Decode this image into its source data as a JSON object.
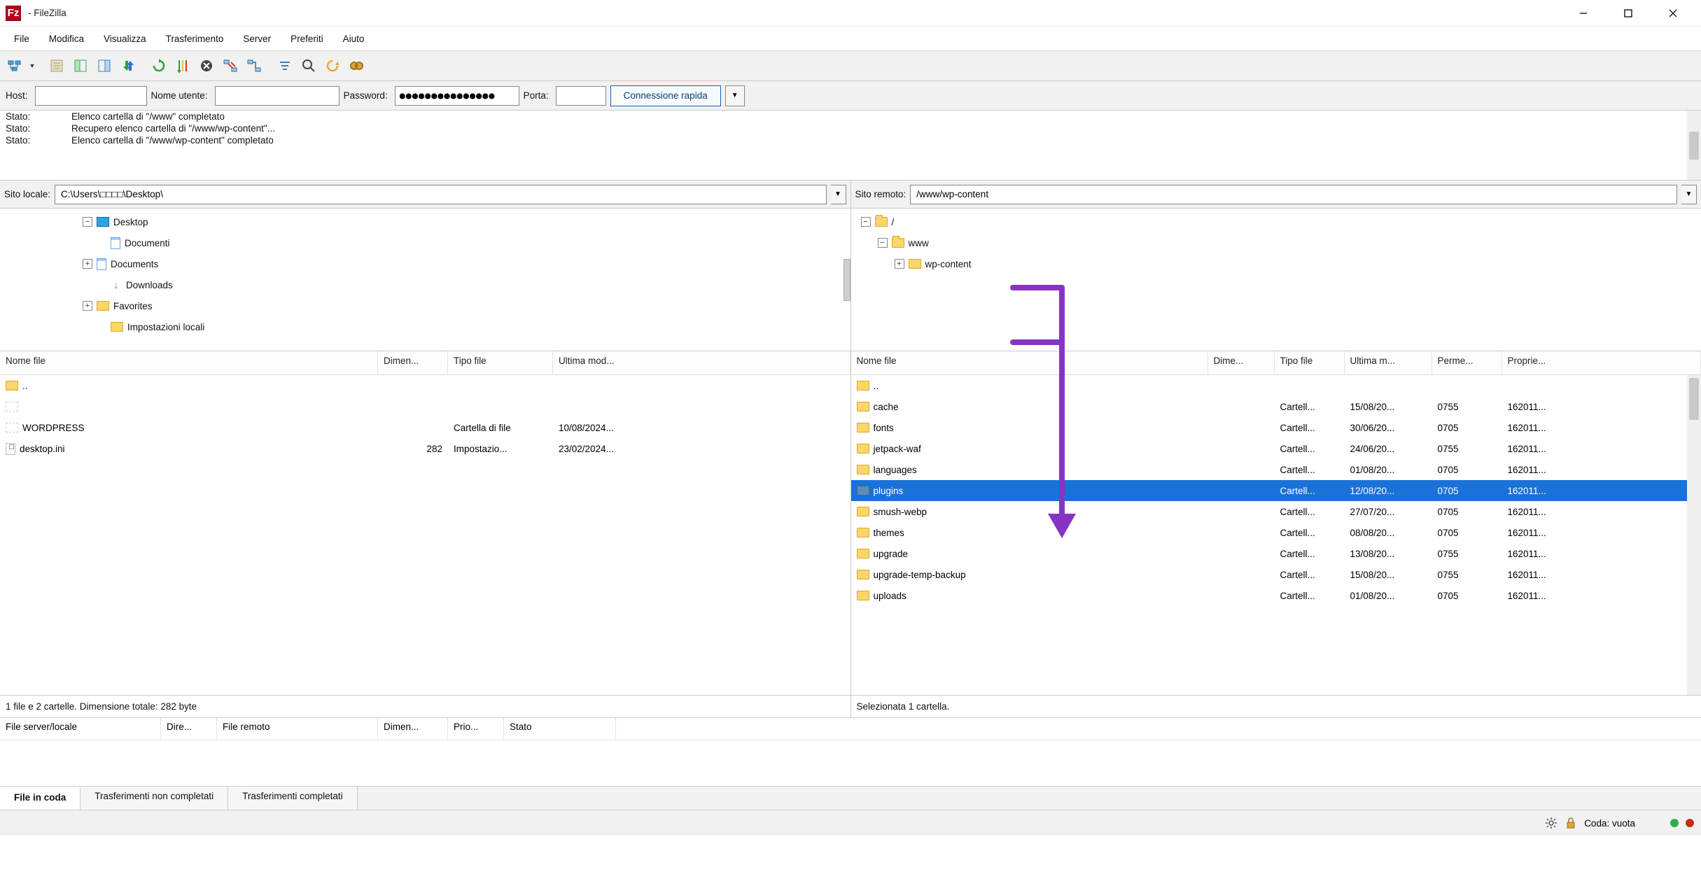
{
  "title": "- FileZilla",
  "menu": {
    "file": "File",
    "edit": "Modifica",
    "view": "Visualizza",
    "transfer": "Trasferimento",
    "server": "Server",
    "bookmarks": "Preferiti",
    "help": "Aiuto"
  },
  "quick": {
    "host_label": "Host:",
    "host": "",
    "user_label": "Nome utente:",
    "user": "",
    "pass_label": "Password:",
    "pass": "●●●●●●●●●●●●●●●",
    "port_label": "Porta:",
    "port": "",
    "connect": "Connessione rapida"
  },
  "log": [
    {
      "lbl": "Stato:",
      "msg": "Elenco cartella di \"/www\" completato"
    },
    {
      "lbl": "Stato:",
      "msg": "Recupero elenco cartella di \"/www/wp-content\"..."
    },
    {
      "lbl": "Stato:",
      "msg": "Elenco cartella di \"/www/wp-content\" completato"
    }
  ],
  "local": {
    "path_label": "Sito locale:",
    "path": "C:\\Users\\□□□□\\Desktop\\",
    "tree": [
      {
        "indent": 110,
        "exp": "-",
        "icon": "desktop",
        "txt": "Desktop"
      },
      {
        "indent": 130,
        "exp": "",
        "icon": "doc",
        "txt": "Documenti"
      },
      {
        "indent": 110,
        "exp": "+",
        "icon": "doc",
        "txt": "Documents"
      },
      {
        "indent": 130,
        "exp": "",
        "icon": "download",
        "txt": "Downloads"
      },
      {
        "indent": 110,
        "exp": "+",
        "icon": "folder",
        "txt": "Favorites"
      },
      {
        "indent": 130,
        "exp": "",
        "icon": "folder",
        "txt": "Impostazioni locali"
      }
    ],
    "headers": {
      "name": "Nome file",
      "size": "Dimen...",
      "type": "Tipo file",
      "mod": "Ultima mod..."
    },
    "rows": [
      {
        "name": "..",
        "icon": "up"
      },
      {
        "name": "",
        "icon": "blank"
      },
      {
        "name": "WORDPRESS",
        "icon": "blank",
        "type": "Cartella di file",
        "mod": "10/08/2024..."
      },
      {
        "name": "desktop.ini",
        "icon": "ini",
        "size": "282",
        "type": "Impostazio...",
        "mod": "23/02/2024..."
      }
    ],
    "foot": "1 file e 2 cartelle. Dimensione totale: 282 byte"
  },
  "remote": {
    "path_label": "Sito remoto:",
    "path": "/www/wp-content",
    "tree": [
      {
        "indent": 6,
        "exp": "-",
        "icon": "folderopen",
        "txt": "/"
      },
      {
        "indent": 30,
        "exp": "-",
        "icon": "folderopen",
        "txt": "www"
      },
      {
        "indent": 54,
        "exp": "+",
        "icon": "folder",
        "txt": "wp-content"
      }
    ],
    "headers": {
      "name": "Nome file",
      "size": "Dime...",
      "type": "Tipo file",
      "mod": "Ultima m...",
      "perm": "Perme...",
      "owner": "Proprie..."
    },
    "rows": [
      {
        "name": "..",
        "icon": "up"
      },
      {
        "name": "cache",
        "icon": "folder",
        "type": "Cartell...",
        "mod": "15/08/20...",
        "perm": "0755",
        "owner": "162011..."
      },
      {
        "name": "fonts",
        "icon": "folder",
        "type": "Cartell...",
        "mod": "30/06/20...",
        "perm": "0705",
        "owner": "162011..."
      },
      {
        "name": "jetpack-waf",
        "icon": "folder",
        "type": "Cartell...",
        "mod": "24/06/20...",
        "perm": "0755",
        "owner": "162011..."
      },
      {
        "name": "languages",
        "icon": "folder",
        "type": "Cartell...",
        "mod": "01/08/20...",
        "perm": "0705",
        "owner": "162011..."
      },
      {
        "name": "plugins",
        "icon": "folder",
        "type": "Cartell...",
        "mod": "12/08/20...",
        "perm": "0705",
        "owner": "162011...",
        "selected": true
      },
      {
        "name": "smush-webp",
        "icon": "folder",
        "type": "Cartell...",
        "mod": "27/07/20...",
        "perm": "0705",
        "owner": "162011..."
      },
      {
        "name": "themes",
        "icon": "folder",
        "type": "Cartell...",
        "mod": "08/08/20...",
        "perm": "0705",
        "owner": "162011..."
      },
      {
        "name": "upgrade",
        "icon": "folder",
        "type": "Cartell...",
        "mod": "13/08/20...",
        "perm": "0755",
        "owner": "162011..."
      },
      {
        "name": "upgrade-temp-backup",
        "icon": "folder",
        "type": "Cartell...",
        "mod": "15/08/20...",
        "perm": "0755",
        "owner": "162011..."
      },
      {
        "name": "uploads",
        "icon": "folder",
        "type": "Cartell...",
        "mod": "01/08/20...",
        "perm": "0705",
        "owner": "162011..."
      }
    ],
    "foot": "Selezionata 1 cartella."
  },
  "queue": {
    "headers": [
      "File server/locale",
      "Dire...",
      "File remoto",
      "Dimen...",
      "Prio...",
      "Stato"
    ]
  },
  "queuetabs": {
    "t1": "File in coda",
    "t2": "Trasferimenti non completati",
    "t3": "Trasferimenti completati"
  },
  "statusbar": {
    "queue": "Coda: vuota"
  }
}
